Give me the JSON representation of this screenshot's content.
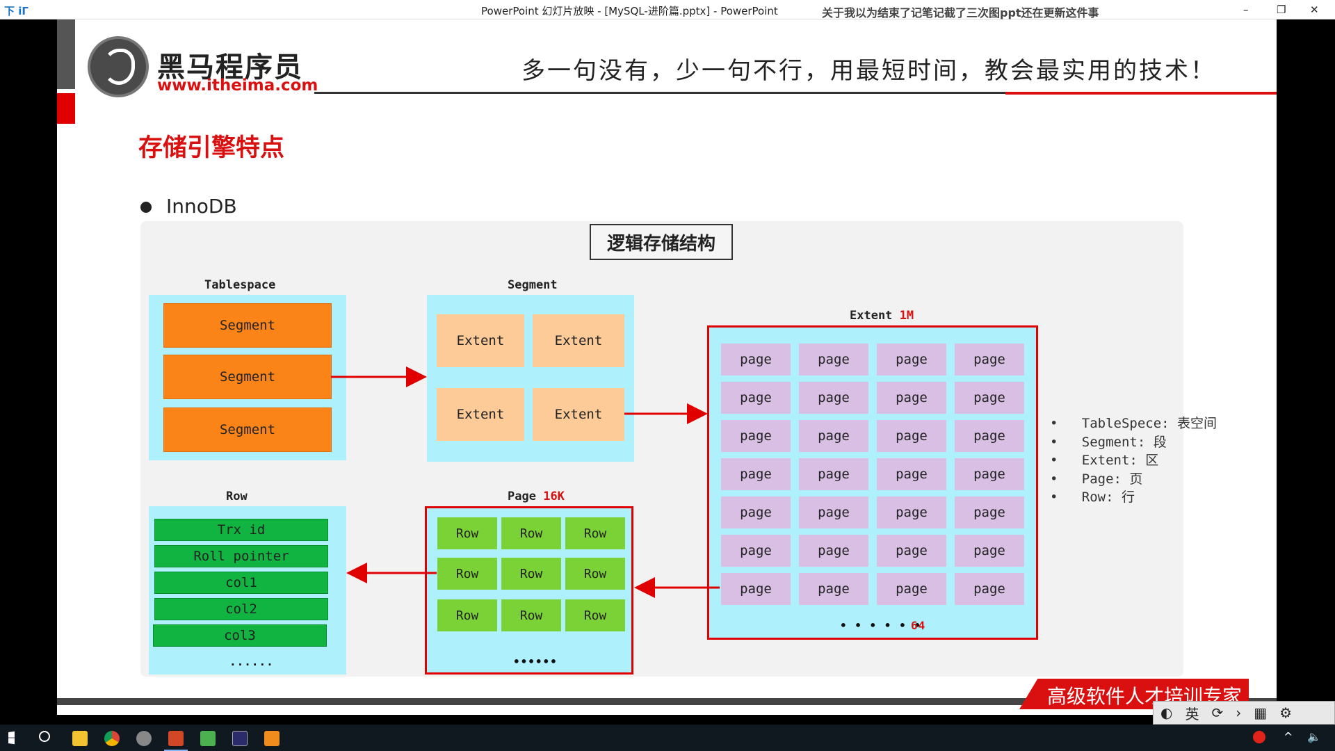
{
  "window": {
    "app_icons_left": "下 iΓ",
    "title": "PowerPoint 幻灯片放映 - [MySQL-进阶篇.pptx] - PowerPoint",
    "overlay_text": "关于我以为结束了记笔记截了三次图ppt还在更新这件事",
    "controls": {
      "minimize": "–",
      "restore": "❐",
      "close": "✕"
    }
  },
  "slide": {
    "brand_cn": "黑马程序员",
    "brand_url": "www.itheima.com",
    "slogan": "多一句没有，少一句不行，用最短时间，教会最实用的技术！",
    "heading": "存储引擎特点",
    "bullet": "InnoDB",
    "diagram": {
      "title": "逻辑存储结构",
      "tablespace": {
        "label": "Tablespace",
        "items": [
          "Segment",
          "Segment",
          "Segment"
        ]
      },
      "segment": {
        "label": "Segment",
        "items": [
          "Extent",
          "Extent",
          "Extent",
          "Extent"
        ]
      },
      "extent": {
        "label": "Extent",
        "size": "1M",
        "cell": "page",
        "more": "• • • • • •",
        "count": "64"
      },
      "page": {
        "label": "Page",
        "size": "16K",
        "cell": "Row",
        "more": "••••••"
      },
      "row": {
        "label": "Row",
        "fields": [
          "Trx id",
          "Roll pointer",
          "col1",
          "col2",
          "col3"
        ],
        "more": "......"
      }
    },
    "legend": [
      "TableSpece: 表空间",
      "Segment: 段",
      "Extent: 区",
      "Page: 页",
      "Row: 行"
    ],
    "footer_banner": "高级软件人才培训专家"
  },
  "overlay_toolbar": {
    "ime": "英",
    "items": [
      "⟳",
      "›",
      "▦",
      "⚙"
    ]
  },
  "colors": {
    "accent_red": "#d9100f",
    "diagram_cyan": "#aef0fb",
    "segment_orange": "#fa8418",
    "extent_peach": "#fdcb98",
    "page_purple": "#d8bfe3",
    "row_green": "#7bd236",
    "field_green": "#11b341"
  }
}
